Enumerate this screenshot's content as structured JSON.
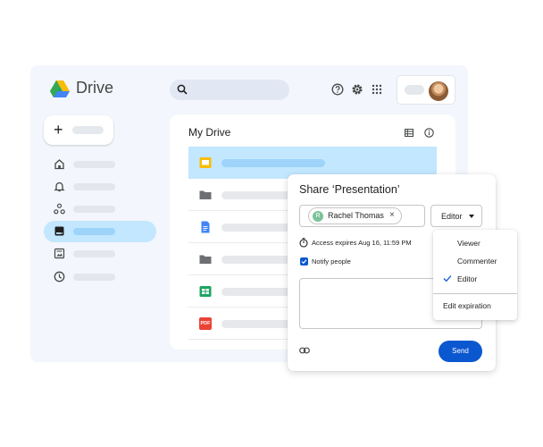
{
  "app": {
    "name": "Drive"
  },
  "header": {
    "search_icon": "search-icon",
    "help_icon": "help-icon",
    "settings_icon": "gear-icon",
    "apps_icon": "apps-grid-icon"
  },
  "sidebar": {
    "new_icon": "plus-icon",
    "new_label": "+",
    "items": [
      {
        "icon": "home-icon",
        "active": false
      },
      {
        "icon": "bell-icon",
        "active": false
      },
      {
        "icon": "shared-icon",
        "active": false
      },
      {
        "icon": "drive-icon",
        "active": true
      },
      {
        "icon": "photos-icon",
        "active": false
      },
      {
        "icon": "clock-icon",
        "active": false
      }
    ]
  },
  "main": {
    "title": "My Drive",
    "files": [
      {
        "type": "slides",
        "selected": true
      },
      {
        "type": "folder",
        "selected": false
      },
      {
        "type": "docs",
        "selected": false
      },
      {
        "type": "folder",
        "selected": false
      },
      {
        "type": "sheets",
        "selected": false
      },
      {
        "type": "pdf",
        "selected": false,
        "label": "PDF"
      }
    ]
  },
  "share_dialog": {
    "title": "Share ‘Presentation’",
    "chip": {
      "initial": "R",
      "name": "Rachel Thomas",
      "remove": "×"
    },
    "role": "Editor",
    "expires": "Access expires Aug 16, 11:59 PM",
    "notify": "Notify people",
    "notify_checked": true,
    "send": "Send"
  },
  "role_menu": {
    "items": [
      "Viewer",
      "Commenter",
      "Editor"
    ],
    "selected": "Editor",
    "extra": "Edit expiration"
  },
  "colors": {
    "accent": "#0b57d0",
    "selected_bg": "#c2e7ff",
    "window_bg": "#f3f6fc"
  }
}
